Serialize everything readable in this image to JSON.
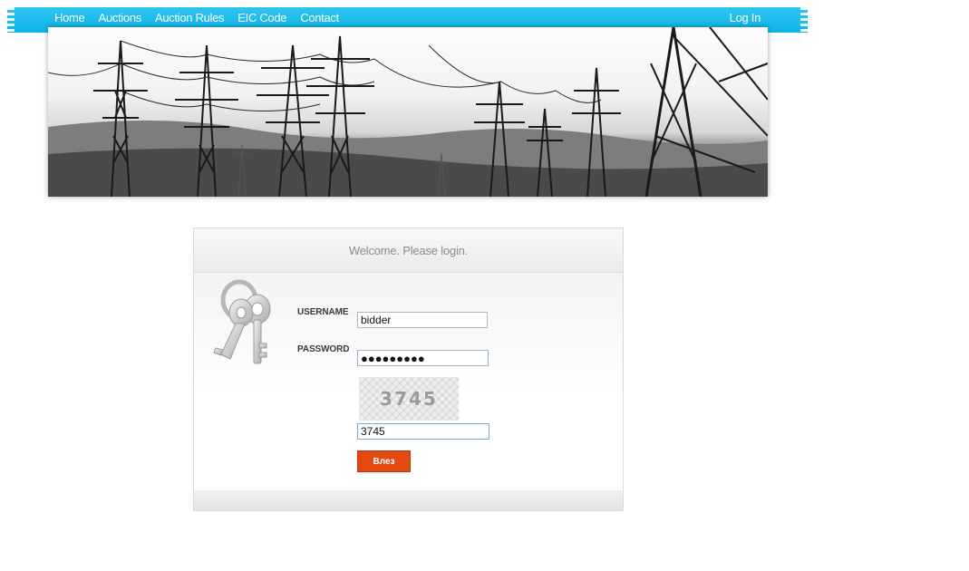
{
  "nav": {
    "links": [
      "Home",
      "Auctions",
      "Auction Rules",
      "EIC Code",
      "Contact"
    ],
    "login": "Log In"
  },
  "login": {
    "header": "Welcome. Please login.",
    "username_label": "USERNAME",
    "username_value": "bidder",
    "password_label": "PASSWORD",
    "password_value": "●●●●●●●●●",
    "captcha_text": "3745",
    "captcha_value": "3745",
    "submit_label": "Влез"
  },
  "colors": {
    "nav_bar": "#0db3e8",
    "submit_button": "#e24a12"
  },
  "icons": [
    "keys-icon"
  ]
}
